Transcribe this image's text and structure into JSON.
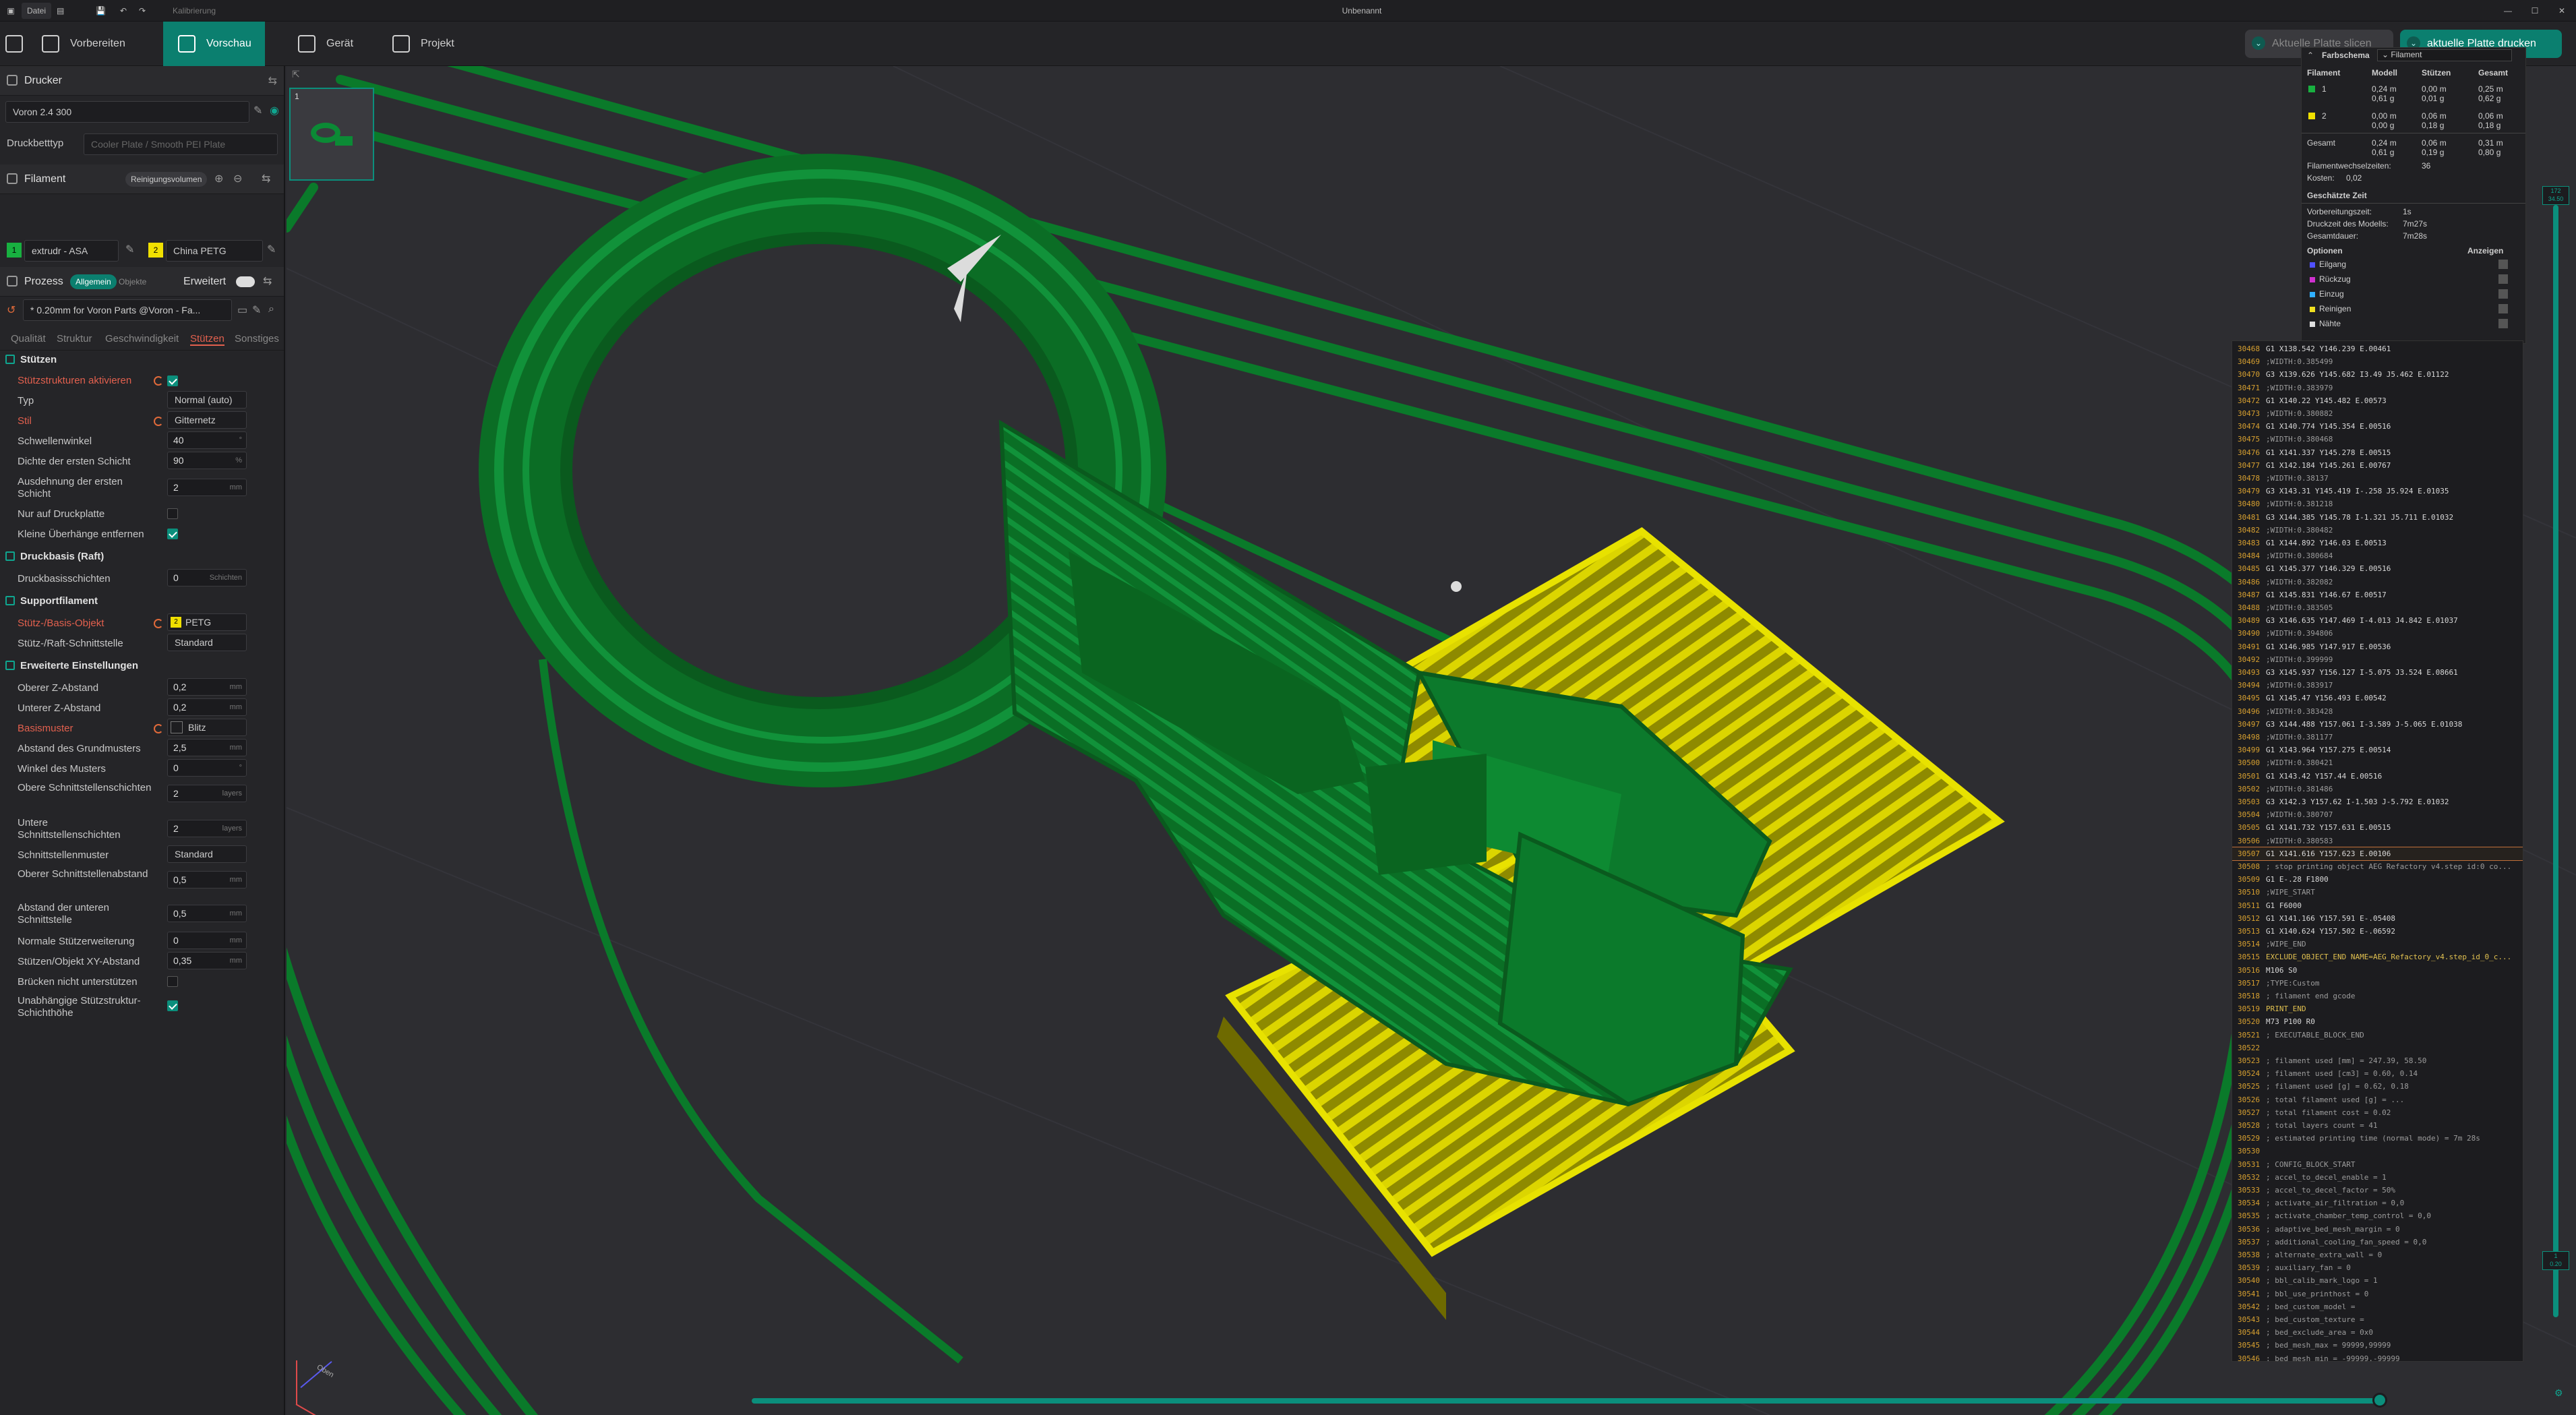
{
  "titlebar": {
    "file_menu": "Datei",
    "calibration": "Kalibrierung",
    "window_title": "Unbenannt",
    "minimize": "—",
    "maximize": "☐",
    "close": "✕"
  },
  "menubar": {
    "tabs": [
      {
        "label": "Vorbereiten",
        "active": false
      },
      {
        "label": "Vorschau",
        "active": true
      },
      {
        "label": "Gerät",
        "active": false
      },
      {
        "label": "Projekt",
        "active": false
      }
    ],
    "slice_button": "Aktuelle Platte slicen",
    "print_button": "aktuelle Platte drucken"
  },
  "sidebar": {
    "printer": {
      "title": "Drucker",
      "name": "Voron 2.4 300",
      "bed_label": "Druckbetttyp",
      "bed_value": "Cooler Plate / Smooth PEI Plate",
      "wifi_icon": "wifi-icon"
    },
    "filament": {
      "title": "Filament",
      "cleaning_button": "Reinigungsvolumen",
      "slots": [
        {
          "index": "1",
          "name": "extrudr - ASA",
          "color": "#18b040"
        },
        {
          "index": "2",
          "name": "China PETG",
          "color": "#f0e000"
        }
      ]
    },
    "process": {
      "title": "Prozess",
      "tab_global": "Allgemein",
      "tab_objects": "Objekte",
      "advanced_label": "Erweitert",
      "preset": "* 0.20mm for Voron Parts @Voron - Fa...",
      "subtabs": [
        "Qualität",
        "Struktur",
        "Geschwindigkeit",
        "Stützen",
        "Sonstiges"
      ],
      "active_subtab": "Stützen"
    },
    "groups": {
      "supports": "Stützen",
      "raft": "Druckbasis (Raft)",
      "support_filament": "Supportfilament",
      "advanced": "Erweiterte Einstellungen"
    },
    "settings": {
      "enable_support": {
        "label": "Stützstrukturen aktivieren",
        "checked": true
      },
      "type": {
        "label": "Typ",
        "value": "Normal (auto)"
      },
      "style": {
        "label": "Stil",
        "value": "Gitternetz"
      },
      "threshold_angle": {
        "label": "Schwellenwinkel",
        "value": "40",
        "unit": "°"
      },
      "first_layer_density": {
        "label": "Dichte der ersten Schicht",
        "value": "90",
        "unit": "%"
      },
      "first_layer_expansion": {
        "label": "Ausdehnung der ersten Schicht",
        "value": "2",
        "unit": "mm"
      },
      "on_build_plate_only": {
        "label": "Nur auf Druckplatte",
        "checked": false
      },
      "remove_small_overhangs": {
        "label": "Kleine Überhänge entfernen",
        "checked": true
      },
      "raft_layers": {
        "label": "Druckbasisschichten",
        "value": "0",
        "unit": "Schichten"
      },
      "support_base": {
        "label": "Stütz-/Basis-Objekt",
        "value": "PETG",
        "slot": "2"
      },
      "support_interface": {
        "label": "Stütz-/Raft-Schnittstelle",
        "value": "Standard"
      },
      "top_z": {
        "label": "Oberer Z-Abstand",
        "value": "0,2",
        "unit": "mm"
      },
      "bottom_z": {
        "label": "Unterer Z-Abstand",
        "value": "0,2",
        "unit": "mm"
      },
      "base_pattern": {
        "label": "Basismuster",
        "value": "Blitz"
      },
      "base_spacing": {
        "label": "Abstand des Grundmusters",
        "value": "2,5",
        "unit": "mm"
      },
      "pattern_angle": {
        "label": "Winkel des Musters",
        "value": "0",
        "unit": "°"
      },
      "top_interface_layers": {
        "label": "Obere Schnittstellenschichten",
        "value": "2",
        "unit": "layers"
      },
      "bottom_interface_layers": {
        "label": "Untere Schnittstellenschichten",
        "value": "2",
        "unit": "layers"
      },
      "interface_pattern": {
        "label": "Schnittstellenmuster",
        "value": "Standard"
      },
      "top_interface_spacing": {
        "label": "Oberer Schnittstellenabstand",
        "value": "0,5",
        "unit": "mm"
      },
      "bottom_interface_spacing": {
        "label": "Abstand der unteren Schnittstelle",
        "value": "0,5",
        "unit": "mm"
      },
      "normal_expansion": {
        "label": "Normale Stützerweiterung",
        "value": "0",
        "unit": "mm"
      },
      "xy_distance": {
        "label": "Stützen/Objekt XY-Abstand",
        "value": "0,35",
        "unit": "mm"
      },
      "bridge_no_support": {
        "label": "Brücken nicht unterstützen",
        "checked": false
      },
      "independent_layer_height": {
        "label": "Unabhängige Stützstruktur-Schichthöhe",
        "checked": true
      }
    }
  },
  "viewport": {
    "plate_thumbnail_index": "1",
    "axis_label": "Oben",
    "layer_top": "172\n34.50",
    "layer_bottom": "1\n0.20",
    "colors": {
      "green": "#0d7a2a",
      "yellow": "#d8d400",
      "bed": "#2d2d31"
    }
  },
  "legend": {
    "color_scheme_label": "Farbschema",
    "color_scheme_value": "Filament",
    "headers": [
      "Filament",
      "Modell",
      "Stützen",
      "Gesamt"
    ],
    "rows": [
      {
        "index": "1",
        "color": "#18b040",
        "model": "0,24 m\n0,61 g",
        "support": "0,00 m\n0,01 g",
        "total": "0,25 m\n0,62 g"
      },
      {
        "index": "2",
        "color": "#f0e000",
        "model": "0,00 m\n0,00 g",
        "support": "0,06 m\n0,18 g",
        "total": "0,06 m\n0,18 g"
      }
    ],
    "total_label": "Gesamt",
    "total_model": "0,24 m\n0,61 g",
    "total_support": "0,06 m\n0,19 g",
    "total_total": "0,31 m\n0,80 g",
    "filament_changes_label": "Filamentwechselzeiten:",
    "filament_changes_value": "36",
    "cost_label": "Kosten:",
    "cost_value": "0,02",
    "estimated_time_title": "Geschätzte Zeit",
    "prep_label": "Vorbereitungszeit:",
    "prep_value": "1s",
    "model_time_label": "Druckzeit des Modells:",
    "model_time_value": "7m27s",
    "total_time_label": "Gesamtdauer:",
    "total_time_value": "7m28s",
    "options_label": "Optionen",
    "show_label": "Anzeigen",
    "options": [
      {
        "label": "Eilgang",
        "color": "#5050ff"
      },
      {
        "label": "Rückzug",
        "color": "#d030d0"
      },
      {
        "label": "Einzug",
        "color": "#30b0ff"
      },
      {
        "label": "Reinigen",
        "color": "#f0e020"
      },
      {
        "label": "Nähte",
        "color": "#e0e0e0"
      }
    ]
  },
  "gcode": [
    [
      "30468",
      "G1 X138.542 Y146.239 E.00461",
      "n"
    ],
    [
      "30469",
      ";WIDTH:0.385499",
      "c"
    ],
    [
      "30470",
      "G3 X139.626 Y145.682 I3.49 J5.462 E.01122",
      "n"
    ],
    [
      "30471",
      ";WIDTH:0.383979",
      "c"
    ],
    [
      "30472",
      "G1 X140.22 Y145.482 E.00573",
      "n"
    ],
    [
      "30473",
      ";WIDTH:0.380882",
      "c"
    ],
    [
      "30474",
      "G1 X140.774 Y145.354 E.00516",
      "n"
    ],
    [
      "30475",
      ";WIDTH:0.380468",
      "c"
    ],
    [
      "30476",
      "G1 X141.337 Y145.278 E.00515",
      "n"
    ],
    [
      "30477",
      "G1 X142.184 Y145.261 E.00767",
      "n"
    ],
    [
      "30478",
      ";WIDTH:0.38137",
      "c"
    ],
    [
      "30479",
      "G3 X143.31 Y145.419 I-.258 J5.924 E.01035",
      "n"
    ],
    [
      "30480",
      ";WIDTH:0.381218",
      "c"
    ],
    [
      "30481",
      "G3 X144.385 Y145.78 I-1.321 J5.711 E.01032",
      "n"
    ],
    [
      "30482",
      ";WIDTH:0.380482",
      "c"
    ],
    [
      "30483",
      "G1 X144.892 Y146.03 E.00513",
      "n"
    ],
    [
      "30484",
      ";WIDTH:0.380684",
      "c"
    ],
    [
      "30485",
      "G1 X145.377 Y146.329 E.00516",
      "n"
    ],
    [
      "30486",
      ";WIDTH:0.382082",
      "c"
    ],
    [
      "30487",
      "G1 X145.831 Y146.67 E.00517",
      "n"
    ],
    [
      "30488",
      ";WIDTH:0.383505",
      "c"
    ],
    [
      "30489",
      "G3 X146.635 Y147.469 I-4.013 J4.842 E.01037",
      "n"
    ],
    [
      "30490",
      ";WIDTH:0.394806",
      "c"
    ],
    [
      "30491",
      "G1 X146.985 Y147.917 E.00536",
      "n"
    ],
    [
      "30492",
      ";WIDTH:0.399999",
      "c"
    ],
    [
      "30493",
      "G3 X145.937 Y156.127 I-5.075 J3.524 E.08661",
      "n"
    ],
    [
      "30494",
      ";WIDTH:0.383917",
      "c"
    ],
    [
      "30495",
      "G1 X145.47 Y156.493 E.00542",
      "n"
    ],
    [
      "30496",
      ";WIDTH:0.383428",
      "c"
    ],
    [
      "30497",
      "G3 X144.488 Y157.061 I-3.589 J-5.065 E.01038",
      "n"
    ],
    [
      "30498",
      ";WIDTH:0.381177",
      "c"
    ],
    [
      "30499",
      "G1 X143.964 Y157.275 E.00514",
      "n"
    ],
    [
      "30500",
      ";WIDTH:0.380421",
      "c"
    ],
    [
      "30501",
      "G1 X143.42 Y157.44 E.00516",
      "n"
    ],
    [
      "30502",
      ";WIDTH:0.381486",
      "c"
    ],
    [
      "30503",
      "G3 X142.3 Y157.62 I-1.503 J-5.792 E.01032",
      "n"
    ],
    [
      "30504",
      ";WIDTH:0.380707",
      "c"
    ],
    [
      "30505",
      "G1 X141.732 Y157.631 E.00515",
      "n"
    ],
    [
      "30506",
      ";WIDTH:0.380583",
      "c"
    ],
    [
      "30507",
      "G1 X141.616 Y157.623 E.00106",
      "h"
    ],
    [
      "30508",
      "; stop printing object AEG Refactory v4.step id:0 co...",
      "c"
    ],
    [
      "30509",
      "G1 E-.28 F1800",
      "n"
    ],
    [
      "30510",
      ";WIPE_START",
      "c"
    ],
    [
      "30511",
      "G1 F6000",
      "n"
    ],
    [
      "30512",
      "G1 X141.166 Y157.591 E-.05408",
      "n"
    ],
    [
      "30513",
      "G1 X140.624 Y157.502 E-.06592",
      "n"
    ],
    [
      "30514",
      ";WIPE_END",
      "c"
    ],
    [
      "30515",
      "EXCLUDE_OBJECT_END NAME=AEG_Refactory_v4.step_id_0_c...",
      "k"
    ],
    [
      "30516",
      "M106 S0",
      "n"
    ],
    [
      "30517",
      ";TYPE:Custom",
      "c"
    ],
    [
      "30518",
      "; filament end gcode",
      "c"
    ],
    [
      "30519",
      "PRINT_END",
      "k"
    ],
    [
      "30520",
      "M73 P100 R0",
      "n"
    ],
    [
      "30521",
      "; EXECUTABLE_BLOCK_END",
      "c"
    ],
    [
      "30522",
      "",
      "c"
    ],
    [
      "30523",
      "; filament used [mm] = 247.39, 58.50",
      "c"
    ],
    [
      "30524",
      "; filament used [cm3] = 0.60, 0.14",
      "c"
    ],
    [
      "30525",
      "; filament used [g] = 0.62, 0.18",
      "c"
    ],
    [
      "30526",
      "; total filament used [g] = ...",
      "c"
    ],
    [
      "30527",
      "; total filament cost = 0.02",
      "c"
    ],
    [
      "30528",
      "; total layers count = 41",
      "c"
    ],
    [
      "30529",
      "; estimated printing time (normal mode) = 7m 28s",
      "c"
    ],
    [
      "30530",
      "",
      "c"
    ],
    [
      "30531",
      "; CONFIG_BLOCK_START",
      "c"
    ],
    [
      "30532",
      "; accel_to_decel_enable = 1",
      "c"
    ],
    [
      "30533",
      "; accel_to_decel_factor = 50%",
      "c"
    ],
    [
      "30534",
      "; activate_air_filtration = 0,0",
      "c"
    ],
    [
      "30535",
      "; activate_chamber_temp_control = 0,0",
      "c"
    ],
    [
      "30536",
      "; adaptive_bed_mesh_margin = 0",
      "c"
    ],
    [
      "30537",
      "; additional_cooling_fan_speed = 0,0",
      "c"
    ],
    [
      "30538",
      "; alternate_extra_wall = 0",
      "c"
    ],
    [
      "30539",
      "; auxiliary_fan = 0",
      "c"
    ],
    [
      "30540",
      "; bbl_calib_mark_logo = 1",
      "c"
    ],
    [
      "30541",
      "; bbl_use_printhost = 0",
      "c"
    ],
    [
      "30542",
      "; bed_custom_model =",
      "c"
    ],
    [
      "30543",
      "; bed_custom_texture =",
      "c"
    ],
    [
      "30544",
      "; bed_exclude_area = 0x0",
      "c"
    ],
    [
      "30545",
      "; bed_mesh_max = 99999,99999",
      "c"
    ],
    [
      "30546",
      "; bed_mesh_min = -99999,-99999",
      "c"
    ]
  ]
}
